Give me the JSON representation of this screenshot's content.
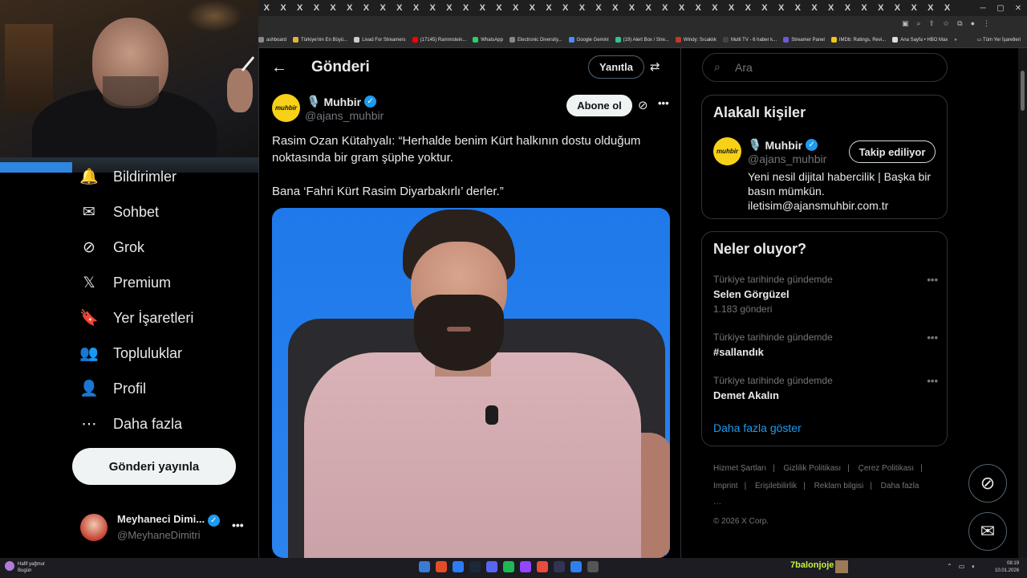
{
  "browser": {
    "tab_glyph": "X",
    "tab_count": 42,
    "bookmarks": [
      {
        "label": "ashboard",
        "color": "#888888"
      },
      {
        "label": "Türkiye'nin En Büyü...",
        "color": "#e3b341"
      },
      {
        "label": "Livad For Streamers",
        "color": "#cccccc"
      },
      {
        "label": "(17145) Rammstein...",
        "color": "#ff0000"
      },
      {
        "label": "WhatsApp",
        "color": "#25d366"
      },
      {
        "label": "Electronic Diversity...",
        "color": "#888888"
      },
      {
        "label": "Google Gemini",
        "color": "#4b8df8"
      },
      {
        "label": "(19) Alert Box / Stre...",
        "color": "#31c48d"
      },
      {
        "label": "Windy: Sıcaklık",
        "color": "#c0392b"
      },
      {
        "label": "Multi TV - 6 haber k...",
        "color": "#444444"
      },
      {
        "label": "Streamer Panel",
        "color": "#6b5bd6"
      },
      {
        "label": "IMDb: Ratings, Revi...",
        "color": "#f5c518"
      },
      {
        "label": "Ana Sayfa • HBO Max",
        "color": "#dddddd"
      }
    ],
    "bookmarks_overflow": "»",
    "all_bookmarks": "Tüm Yer İşaretleri"
  },
  "nav": {
    "items": [
      {
        "label": "Bildirimler",
        "icon": "bell-icon",
        "glyph": "🔔"
      },
      {
        "label": "Sohbet",
        "icon": "mail-icon",
        "glyph": "✉"
      },
      {
        "label": "Grok",
        "icon": "grok-icon",
        "glyph": "⊘"
      },
      {
        "label": "Premium",
        "icon": "x-logo-icon",
        "glyph": "𝕏"
      },
      {
        "label": "Yer İşaretleri",
        "icon": "bookmark-icon",
        "glyph": "🔖"
      },
      {
        "label": "Topluluklar",
        "icon": "people-icon",
        "glyph": "👥"
      },
      {
        "label": "Profil",
        "icon": "person-icon",
        "glyph": "👤"
      },
      {
        "label": "Daha fazla",
        "icon": "more-circle-icon",
        "glyph": "⋯"
      }
    ],
    "post_button": "Gönderi yayınla",
    "account": {
      "name": "Meyhaneci Dimi...",
      "handle": "@MeyhaneDimitri",
      "more": "•••"
    }
  },
  "main": {
    "back_glyph": "←",
    "title": "Gönderi",
    "reply_button": "Yanıtla",
    "filter_glyph": "⇄",
    "post": {
      "avatar_text": "muhbir",
      "author_emoji": "🎙️",
      "author": "Muhbir",
      "verified_glyph": "✓",
      "handle": "@ajans_muhbir",
      "subscribe_button": "Abone ol",
      "grok_glyph": "⊘",
      "more": "•••",
      "text_line1": "Rasim Ozan Kütahyalı: “Herhalde benim Kürt halkının dostu olduğum",
      "text_line2": "noktasında bir gram şüphe yoktur.",
      "text_line3": "Bana ‘Fahri Kürt Rasim Diyarbakırlı’ derler.”"
    }
  },
  "right": {
    "search_placeholder": "Ara",
    "search_glyph": "⌕",
    "related": {
      "title": "Alakalı kişiler",
      "avatar_text": "muhbir",
      "emoji": "🎙️",
      "name": "Muhbir",
      "handle": "@ajans_muhbir",
      "follow_button": "Takip ediliyor",
      "bio": "Yeni nesil dijital habercilik | Başka bir basın mümkün. iletisim@ajansmuhbir.com.tr"
    },
    "trends": {
      "title": "Neler oluyor?",
      "items": [
        {
          "context": "Türkiye tarihinde gündemde",
          "topic": "Selen Görgüzel",
          "count": "1.183 gönderi"
        },
        {
          "context": "Türkiye tarihinde gündemde",
          "topic": "#sallandık",
          "count": ""
        },
        {
          "context": "Türkiye tarihinde gündemde",
          "topic": "Demet Akalın",
          "count": ""
        }
      ],
      "more_glyph": "•••",
      "show_more": "Daha fazla göster"
    },
    "footer": [
      "Hizmet Şartları",
      "|",
      "Gizlilik Politikası",
      "|",
      "Çerez Politikası",
      "|",
      "Imprint",
      "|",
      "Erişilebilirlik",
      "|",
      "Reklam bilgisi",
      "|",
      "Daha fazla ···",
      "© 2026 X Corp."
    ],
    "fab_grok_glyph": "⊘",
    "fab_message_glyph": "✉"
  },
  "taskbar": {
    "weather_line1": "Hafif yağmur",
    "weather_line2": "Bugün",
    "stream_label": "7balonjoje",
    "time": "08:19",
    "date": "10.01.2026",
    "apps": [
      "#3a7bd5",
      "#e34c26",
      "#2d7cf6",
      "#1b2838",
      "#5865f2",
      "#1db954",
      "#9146ff",
      "#e74c3c",
      "#333355",
      "#2f80ed",
      "#555555"
    ]
  }
}
